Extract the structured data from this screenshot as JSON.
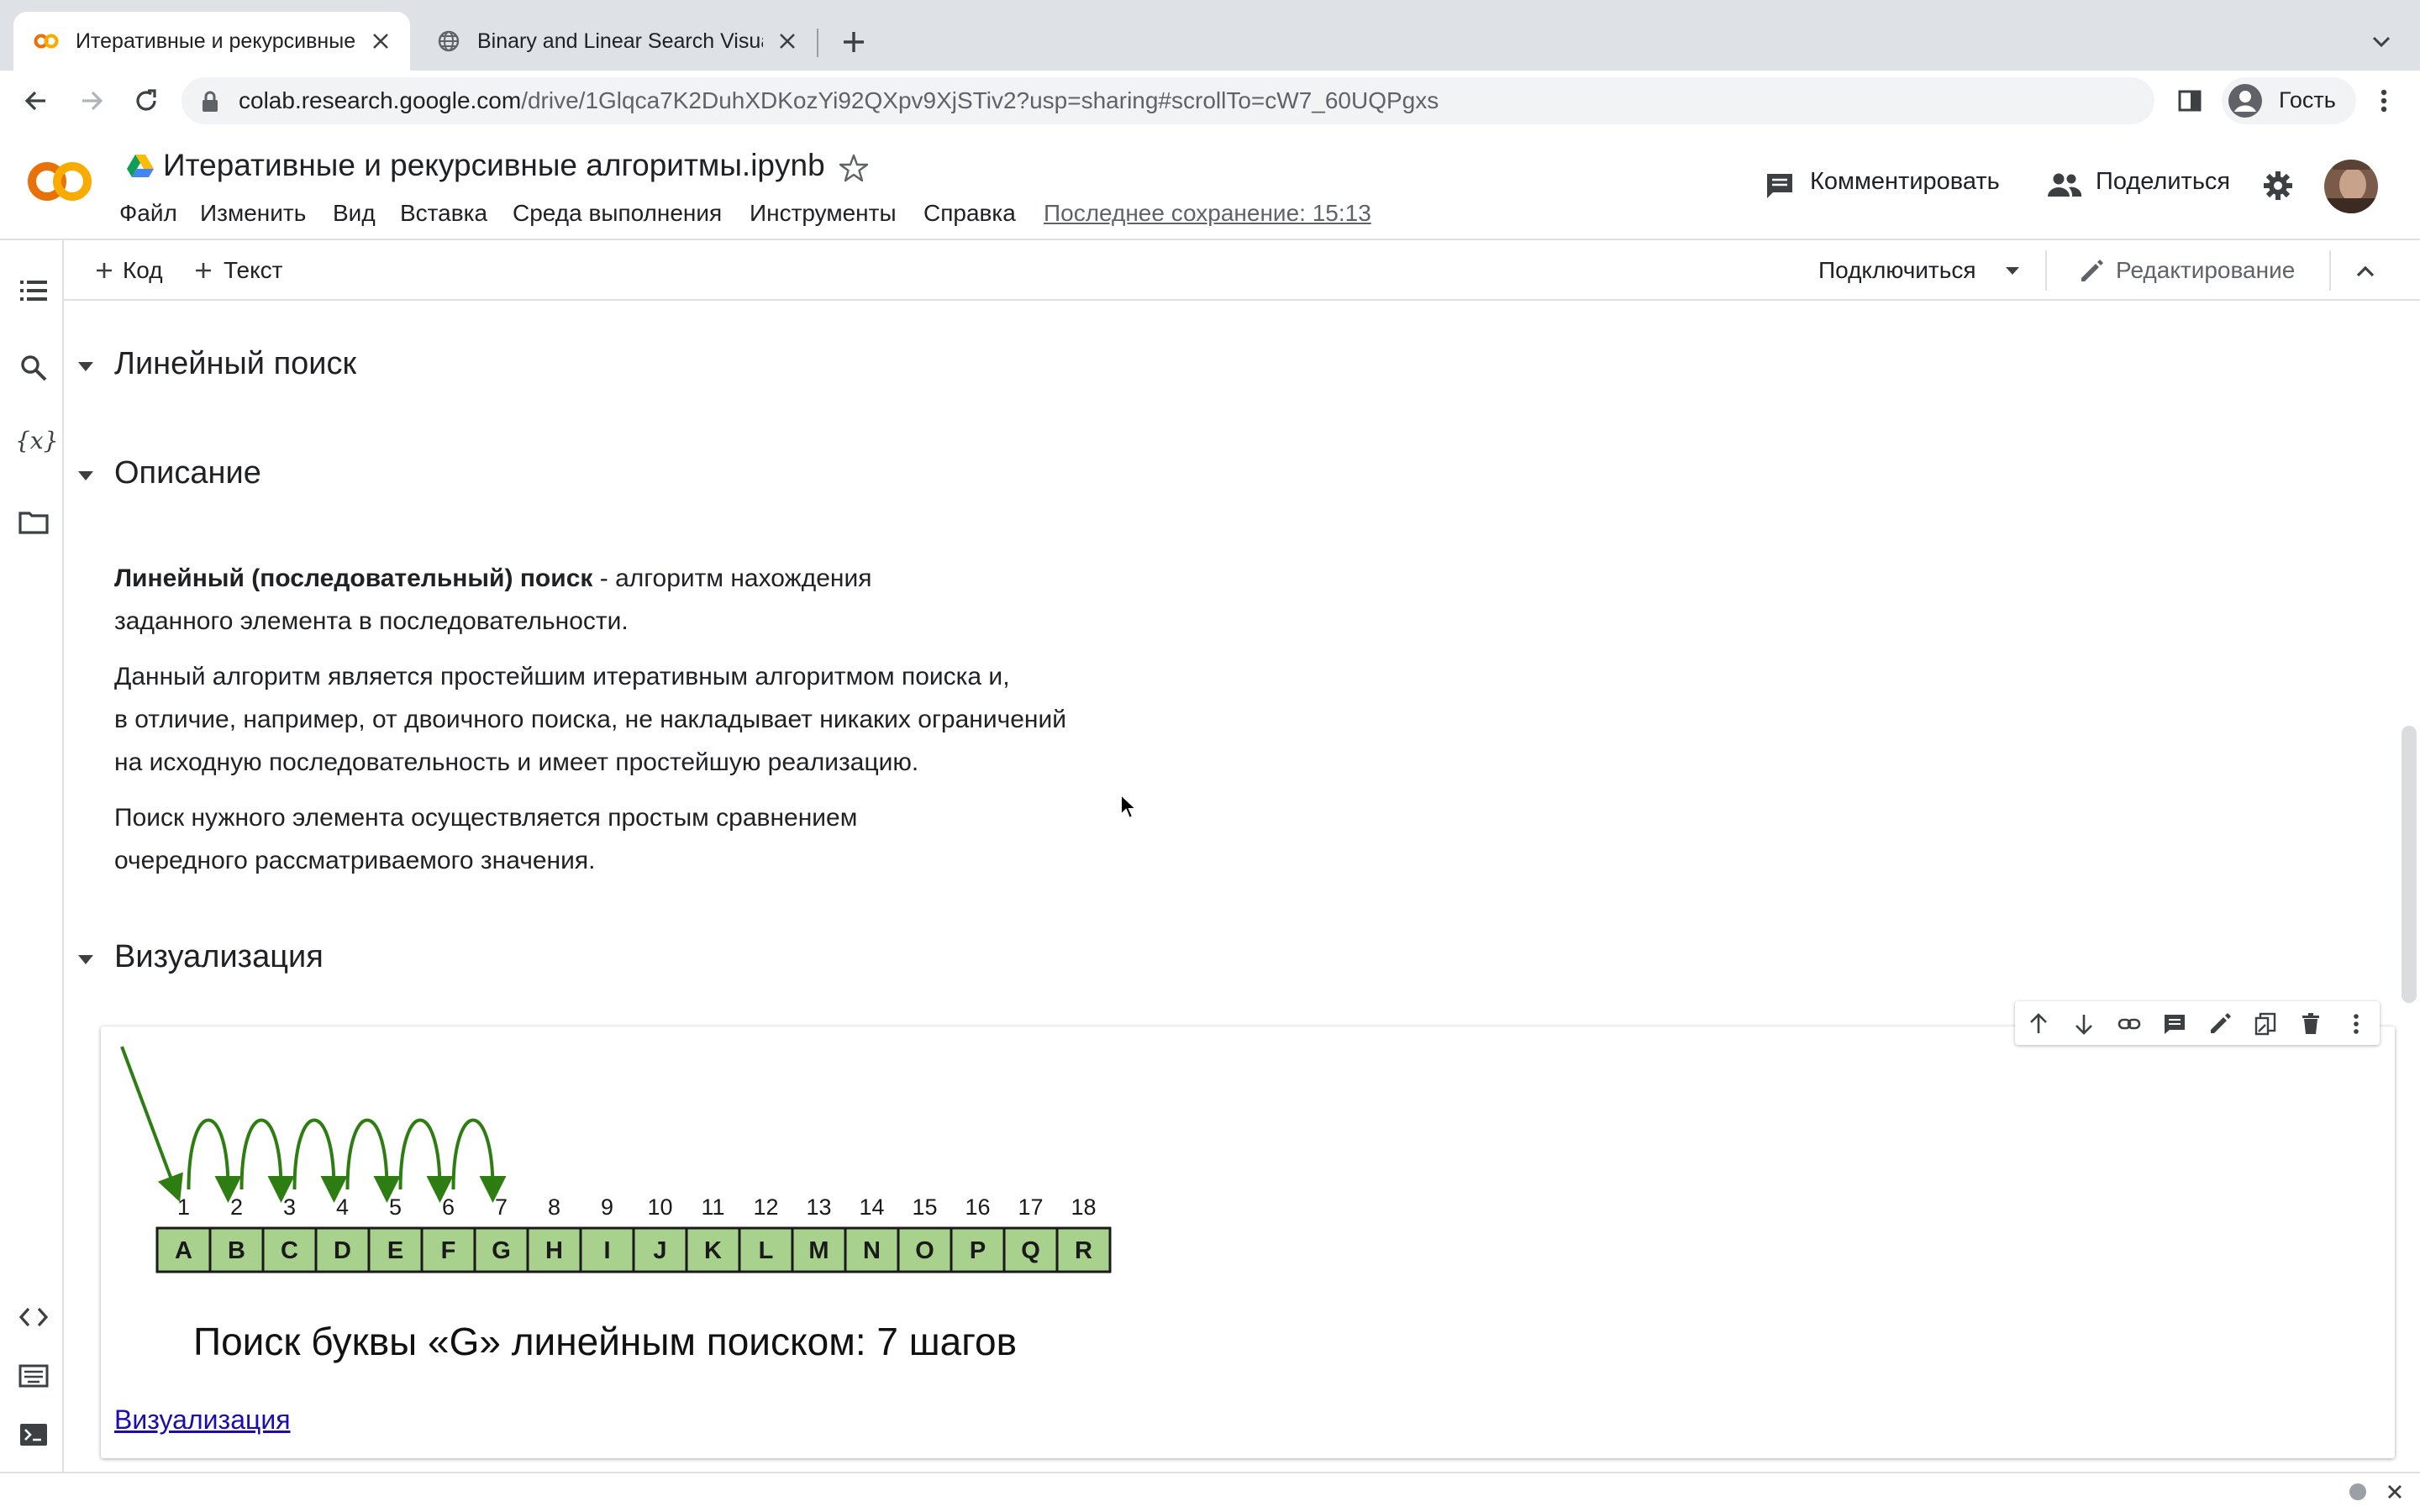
{
  "browser": {
    "tabs": [
      {
        "title": "Итеративные и рекурсивные",
        "active": true
      },
      {
        "title": "Binary and Linear Search Visua",
        "active": false
      }
    ],
    "url_host": "colab.research.google.com",
    "url_path": "/drive/1Glqca7K2DuhXDKozYi92QXpv9XjSTiv2?usp=sharing#scrollTo=cW7_60UQPgxs",
    "profile_label": "Гость"
  },
  "header": {
    "logo_text": "CO",
    "notebook_title": "Итеративные и рекурсивные алгоритмы.ipynb",
    "menu": [
      "Файл",
      "Изменить",
      "Вид",
      "Вставка",
      "Среда выполнения",
      "Инструменты",
      "Справка"
    ],
    "last_saved": "Последнее сохранение: 15:13",
    "comment_label": "Комментировать",
    "share_label": "Поделиться"
  },
  "nb_toolbar": {
    "add_code": "Код",
    "add_text": "Текст",
    "connect": "Подключиться",
    "editing": "Редактирование"
  },
  "content": {
    "h_linear": "Линейный поиск",
    "h_description": "Описание",
    "p1_bold": "Линейный (последовательный) поиск",
    "p1_rest": " - алгоритм нахождения",
    "p1_line2": "заданного элемента в последовательности.",
    "p2_line1": "Данный алгоритм является простейшим итеративным алгоритмом поиска и,",
    "p2_line2": "в отличие, например, от двоичного поиска, не накладывает никаких ограничений",
    "p2_line3": "на исходную последовательность и имеет простейшую реализацию.",
    "p3_line1": "Поиск нужного элемента осуществляется простым сравнением",
    "p3_line2": "очередного рассматриваемого значения.",
    "h_visualization": "Визуализация"
  },
  "visualization": {
    "numbers": [
      "1",
      "2",
      "3",
      "4",
      "5",
      "6",
      "7",
      "8",
      "9",
      "10",
      "11",
      "12",
      "13",
      "14",
      "15",
      "16",
      "17",
      "18"
    ],
    "letters": [
      "A",
      "B",
      "C",
      "D",
      "E",
      "F",
      "G",
      "H",
      "I",
      "J",
      "K",
      "L",
      "M",
      "N",
      "O",
      "P",
      "Q",
      "R"
    ],
    "steps": 7,
    "caption": "Поиск буквы «G» линейным поиском: 7 шагов",
    "link_text": "Визуализация",
    "box_color": "#a9d18e",
    "arrow_color": "#2e7d12"
  },
  "colors": {
    "colab_orange": "#f9ab00",
    "colab_dark_orange": "#e8710a",
    "tab_strip": "#dee1e6",
    "link": "#1a0dab"
  }
}
